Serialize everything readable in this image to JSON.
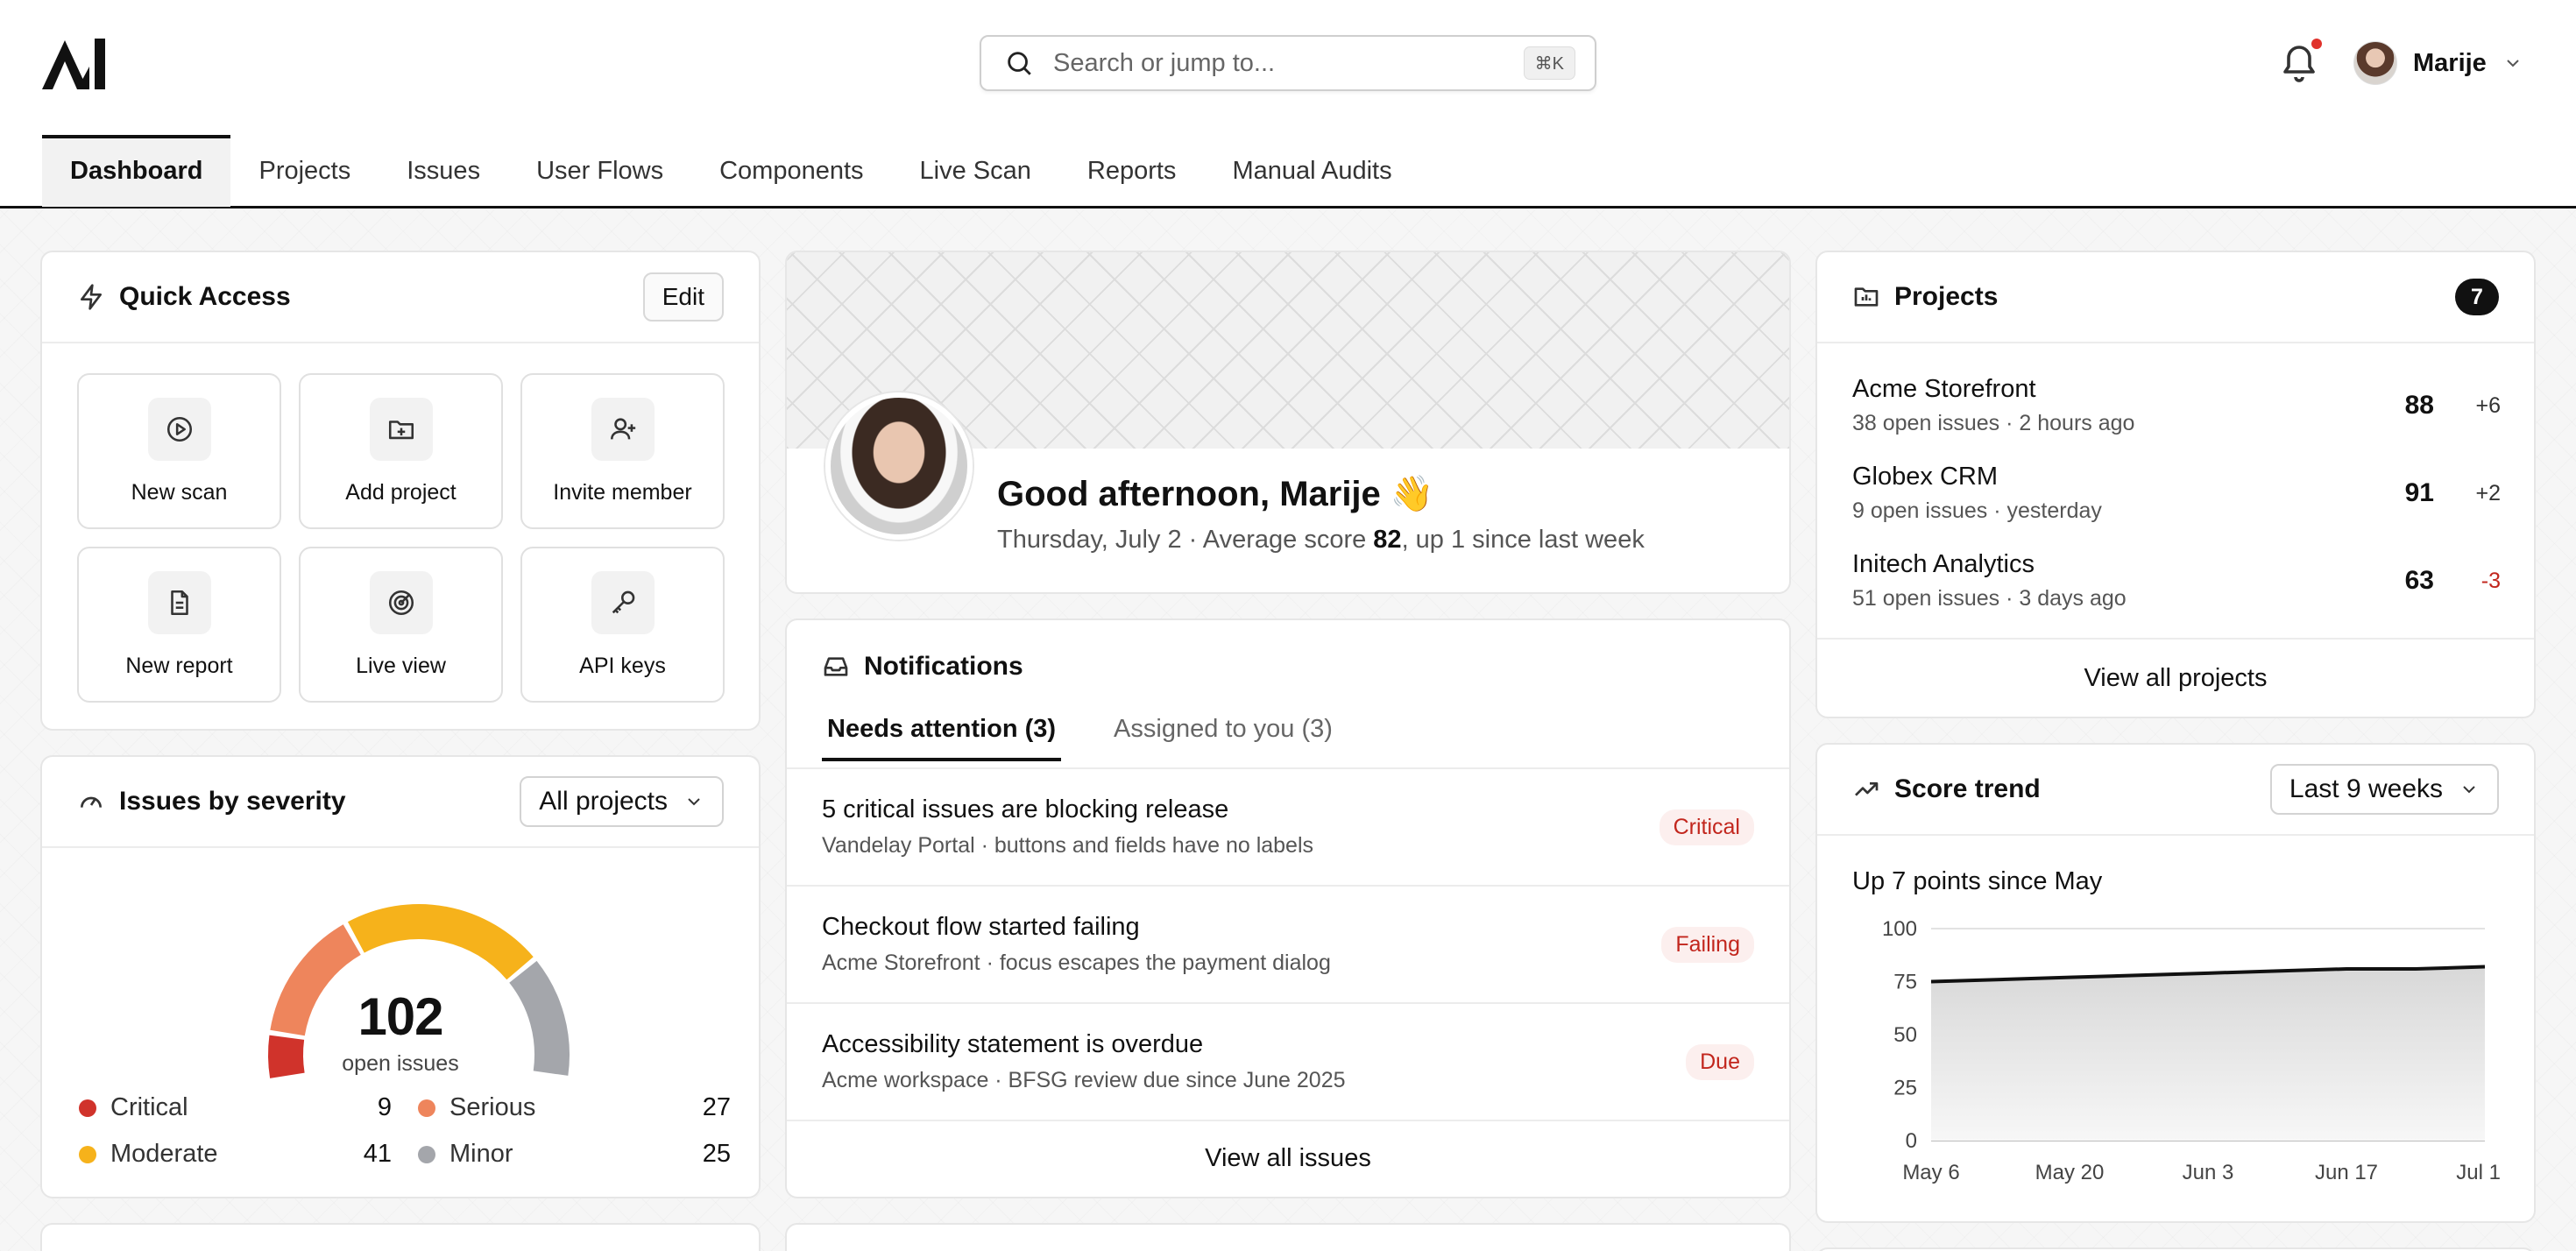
{
  "header": {
    "logo_text": "AI",
    "search_placeholder": "Search or jump to...",
    "search_shortcut": "⌘K",
    "user_name": "Marije"
  },
  "nav": {
    "tabs": [
      "Dashboard",
      "Projects",
      "Issues",
      "User Flows",
      "Components",
      "Live Scan",
      "Reports",
      "Manual Audits"
    ],
    "active": "Dashboard"
  },
  "quick_access": {
    "title": "Quick Access",
    "edit_label": "Edit",
    "tiles": [
      {
        "label": "New scan",
        "icon": "play-circle-icon"
      },
      {
        "label": "Add project",
        "icon": "folder-plus-icon"
      },
      {
        "label": "Invite member",
        "icon": "user-plus-icon"
      },
      {
        "label": "New report",
        "icon": "file-text-icon"
      },
      {
        "label": "Live view",
        "icon": "radar-icon"
      },
      {
        "label": "API keys",
        "icon": "key-icon"
      }
    ]
  },
  "severity": {
    "title": "Issues by severity",
    "filter": "All projects",
    "total": "102",
    "total_label": "open issues",
    "items": [
      {
        "name": "Critical",
        "value": 9,
        "color": "#d0332b"
      },
      {
        "name": "Serious",
        "value": 27,
        "color": "#ee855c"
      },
      {
        "name": "Moderate",
        "value": 41,
        "color": "#f6b21b"
      },
      {
        "name": "Minor",
        "value": 25,
        "color": "#a4a6ab"
      }
    ]
  },
  "hero": {
    "greeting": "Good afternoon, Marije 👋",
    "sub_prefix": "Thursday, July 2 · Average score ",
    "score": "82",
    "sub_suffix": ", up 1 since last week"
  },
  "notifications": {
    "title": "Notifications",
    "tabs": [
      "Needs attention (3)",
      "Assigned to you (3)"
    ],
    "items": [
      {
        "title": "5 critical issues are blocking release",
        "desc": "Vandelay Portal · buttons and fields have no labels",
        "badge": "Critical"
      },
      {
        "title": "Checkout flow started failing",
        "desc": "Acme Storefront · focus escapes the payment dialog",
        "badge": "Failing"
      },
      {
        "title": "Accessibility statement is overdue",
        "desc": "Acme workspace · BFSG review due since June 2025",
        "badge": "Due"
      }
    ],
    "footer": "View all issues"
  },
  "projects": {
    "title": "Projects",
    "count": "7",
    "items": [
      {
        "name": "Acme Storefront",
        "meta": "38 open issues · 2 hours ago",
        "score": "88",
        "delta": "+6"
      },
      {
        "name": "Globex CRM",
        "meta": "9 open issues · yesterday",
        "score": "91",
        "delta": "+2"
      },
      {
        "name": "Initech Analytics",
        "meta": "51 open issues · 3 days ago",
        "score": "63",
        "delta": "-3"
      }
    ],
    "footer": "View all projects"
  },
  "score_trend": {
    "title": "Score trend",
    "range": "Last 9 weeks",
    "caption": "Up 7 points since May"
  },
  "chart_data": {
    "type": "area",
    "x": [
      "May 6",
      "May 13",
      "May 20",
      "May 27",
      "Jun 3",
      "Jun 10",
      "Jun 17",
      "Jun 24",
      "Jul 1"
    ],
    "x_ticks": [
      "May 6",
      "May 20",
      "Jun 3",
      "Jun 17",
      "Jul 1"
    ],
    "values": [
      75,
      76,
      77,
      78,
      79,
      80,
      81,
      81,
      82
    ],
    "ylim": [
      0,
      100
    ],
    "y_ticks": [
      0,
      25,
      50,
      75,
      100
    ],
    "grid": true,
    "color": "#111111"
  }
}
